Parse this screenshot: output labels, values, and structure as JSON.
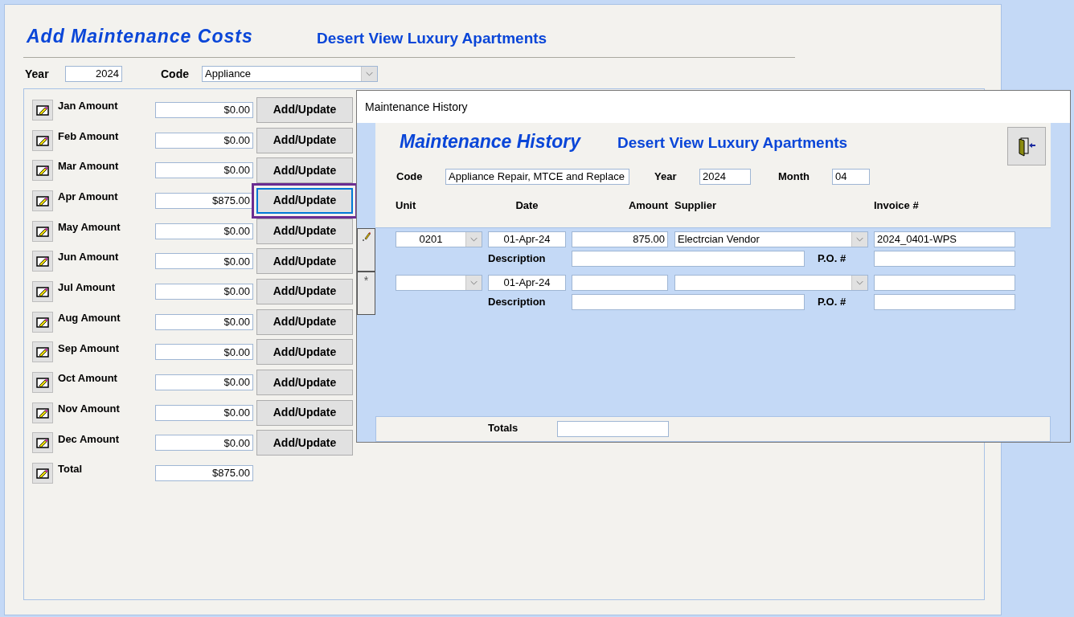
{
  "form": {
    "title": "Add Maintenance Costs",
    "subtitle": "Desert View Luxury Apartments",
    "year_label": "Year",
    "year": "2024",
    "code_label": "Code",
    "code": "Appliance",
    "months": [
      {
        "label": "Jan Amount",
        "amount": "$0.00",
        "button": "Add/Update",
        "focused": false
      },
      {
        "label": "Feb Amount",
        "amount": "$0.00",
        "button": "Add/Update",
        "focused": false
      },
      {
        "label": "Mar Amount",
        "amount": "$0.00",
        "button": "Add/Update",
        "focused": false
      },
      {
        "label": "Apr Amount",
        "amount": "$875.00",
        "button": "Add/Update",
        "focused": true
      },
      {
        "label": "May Amount",
        "amount": "$0.00",
        "button": "Add/Update",
        "focused": false
      },
      {
        "label": "Jun Amount",
        "amount": "$0.00",
        "button": "Add/Update",
        "focused": false
      },
      {
        "label": "Jul Amount",
        "amount": "$0.00",
        "button": "Add/Update",
        "focused": false
      },
      {
        "label": "Aug Amount",
        "amount": "$0.00",
        "button": "Add/Update",
        "focused": false
      },
      {
        "label": "Sep Amount",
        "amount": "$0.00",
        "button": "Add/Update",
        "focused": false
      },
      {
        "label": "Oct Amount",
        "amount": "$0.00",
        "button": "Add/Update",
        "focused": false
      },
      {
        "label": "Nov Amount",
        "amount": "$0.00",
        "button": "Add/Update",
        "focused": false
      },
      {
        "label": "Dec Amount",
        "amount": "$0.00",
        "button": "Add/Update",
        "focused": false
      }
    ],
    "total": {
      "label": "Total",
      "amount": "$875.00"
    }
  },
  "history": {
    "window_title": "Maintenance History",
    "title": "Maintenance History",
    "subtitle": "Desert View Luxury Apartments",
    "code_label": "Code",
    "code": "Appliance Repair, MTCE and Replace",
    "year_label": "Year",
    "year": "2024",
    "month_label": "Month",
    "month": "04",
    "columns": [
      "Unit",
      "Date",
      "Amount",
      "Supplier",
      "Invoice #"
    ],
    "records": [
      {
        "kind": "editing",
        "unit": "0201",
        "date": "01-Apr-24",
        "amount": "875.00",
        "supplier": "Electrcian Vendor",
        "invoice": "2024_0401-WPS",
        "description_label": "Description",
        "po_label": "P.O. #"
      },
      {
        "kind": "new",
        "marker": "*",
        "date": "01-Apr-24",
        "description_label": "Description",
        "po_label": "P.O. #"
      }
    ],
    "totals_label": "Totals"
  }
}
